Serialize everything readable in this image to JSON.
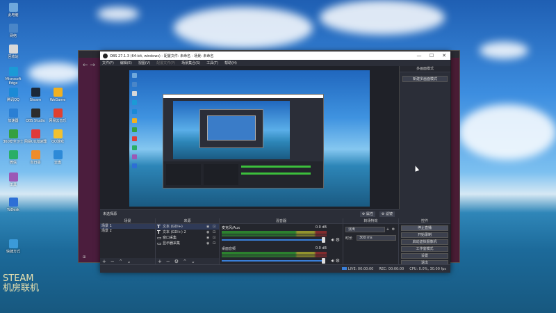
{
  "desktop": {
    "icons": [
      {
        "label": "此电脑",
        "color": "#6fa8dc"
      },
      {
        "label": "网络",
        "color": "#4a86c8"
      },
      {
        "label": "回收站",
        "color": "#d8d8d8"
      },
      {
        "label": "Microsoft Edge",
        "color": "#1c9ad6"
      },
      {
        "label": "腾讯QQ",
        "color": "#1b8ad6"
      },
      {
        "label": "Steam",
        "color": "#1b2838"
      },
      {
        "label": "WeGame",
        "color": "#f0b020"
      },
      {
        "label": "加速器",
        "color": "#2a7fd4"
      },
      {
        "label": "OBS Studio",
        "color": "#2c2c2c"
      },
      {
        "label": "网易云音乐",
        "color": "#e04030"
      },
      {
        "label": "360安全卫士",
        "color": "#35a040"
      },
      {
        "label": "网易UU加速器",
        "color": "#e03a3a"
      },
      {
        "label": "QQ游戏",
        "color": "#f2c12e"
      },
      {
        "label": "微信",
        "color": "#2aae67"
      },
      {
        "label": "向日葵",
        "color": "#f08c2a"
      },
      {
        "label": "云盘",
        "color": "#2d8ad8"
      },
      {
        "label": "工具",
        "color": "#9b59b6"
      },
      {
        "label": "ToDesk",
        "color": "#2d6fd6"
      },
      {
        "label": "快捷方式",
        "color": "#3b9ad9"
      }
    ],
    "watermark_line1": "STEAM",
    "watermark_line2": "机房联机"
  },
  "obs": {
    "title": "OBS 27.1.3 (64-bit, windows) - 配置文件: 未命名 - 场景: 未命名",
    "menu": [
      "文件(F)",
      "编辑(E)",
      "视图(V)",
      "配置文件(P)",
      "场景集合(S)",
      "工具(T)",
      "帮助(H)"
    ],
    "right_panel": {
      "title": "多画面模式",
      "button": "新建多画面模式"
    },
    "status_line": {
      "left": "未选择源",
      "props": "⚙ 属性",
      "filters": "⚙ 滤镜"
    },
    "docks": {
      "scenes": {
        "title": "场景",
        "items": [
          {
            "label": "场景 1",
            "selected": true
          },
          {
            "label": "场景 2",
            "selected": false
          }
        ]
      },
      "sources": {
        "title": "来源",
        "items": [
          {
            "icon": "T",
            "label": "文本 (GDI+)",
            "selected": true
          },
          {
            "icon": "T",
            "label": "文本 (GDI+) 2",
            "selected": false
          },
          {
            "icon": "▭",
            "label": "窗口采集",
            "selected": false
          },
          {
            "icon": "▭",
            "label": "显示器采集",
            "selected": false
          }
        ]
      },
      "mixer": {
        "title": "混音器",
        "channels": [
          {
            "label": "麦克风/Aux",
            "db": "0.0 dB"
          },
          {
            "label": "桌面音频",
            "db": "0.0 dB"
          }
        ]
      },
      "transitions": {
        "title": "转场特效",
        "type": "淡出",
        "duration_label": "时长",
        "duration": "300 ms"
      },
      "controls": {
        "title": "控件",
        "buttons": [
          "停止直播",
          "开始录制",
          "启动虚拟摄像机",
          "工作室模式",
          "设置",
          "退出"
        ]
      }
    },
    "statusbar": {
      "live": "LIVE: 00:00:00",
      "rec": "REC: 00:00:00",
      "cpu": "CPU: 0.0%, 30.00 fps"
    }
  }
}
